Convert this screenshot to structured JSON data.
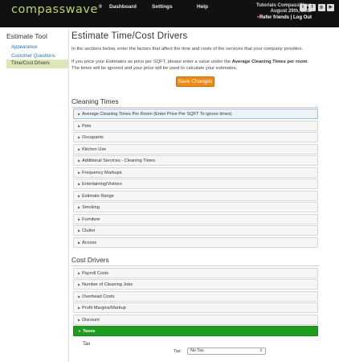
{
  "header": {
    "logo": "compasswave",
    "logo_mark": "®",
    "nav": [
      "Dashboard",
      "Settings",
      "Help"
    ],
    "account_name": "Tutorials CompassWave",
    "date": "August 29th, 2018",
    "refer": "Refer friends",
    "separator": "|",
    "logout": "Log Out",
    "social_icons": [
      "twitter-icon",
      "facebook-icon",
      "instagram-icon",
      "youtube-icon"
    ]
  },
  "sidebar": {
    "title": "Estimate Tool",
    "items": [
      {
        "label": "Appearance",
        "active": false
      },
      {
        "label": "Customer Questions",
        "active": false
      },
      {
        "label": "Time/Cost Drivers",
        "active": true
      }
    ]
  },
  "main": {
    "title": "Estimate Time/Cost Drivers",
    "desc1": "In the sections below, enter the factors that affect the time and costs of the services that your company provides.",
    "desc2_pre": "If you price your Estimates as price per SQFT, please enter a value under the ",
    "desc2_bold": "Average Cleaning Times per room",
    "desc2_post": ". The times will be ignored and your price will be used to calculate your estimates.",
    "save_label": "Save Changes",
    "cleaning_title": "Cleaning Times",
    "cleaning_items": [
      "Average Cleaning Times Per Room (Enter Price Per SQFT To ignore times)",
      "Pets",
      "Occupants",
      "Kitchen Use",
      "Additional Services - Cleaning Times",
      "Frequency Markups",
      "Entertaining/Visitors",
      "Estimate Range",
      "Smoking",
      "Furniture",
      "Clutter",
      "Access"
    ],
    "cost_title": "Cost Drivers",
    "cost_items": [
      "Payroll Costs",
      "Number of Cleaning Jobs",
      "Overhead Costs",
      "Profit Margins/Markup",
      "Discount",
      "Taxes"
    ],
    "tax_section_label": "Tax",
    "tax_field_label": "Tax:",
    "tax_value": "No Tax"
  },
  "colors": {
    "header_bg": "#111111",
    "logo": "#b9d46a",
    "save_button": "#ec8a1a",
    "open_panel": "#1f9c1f",
    "sidebar_active": "#dde8b8"
  }
}
